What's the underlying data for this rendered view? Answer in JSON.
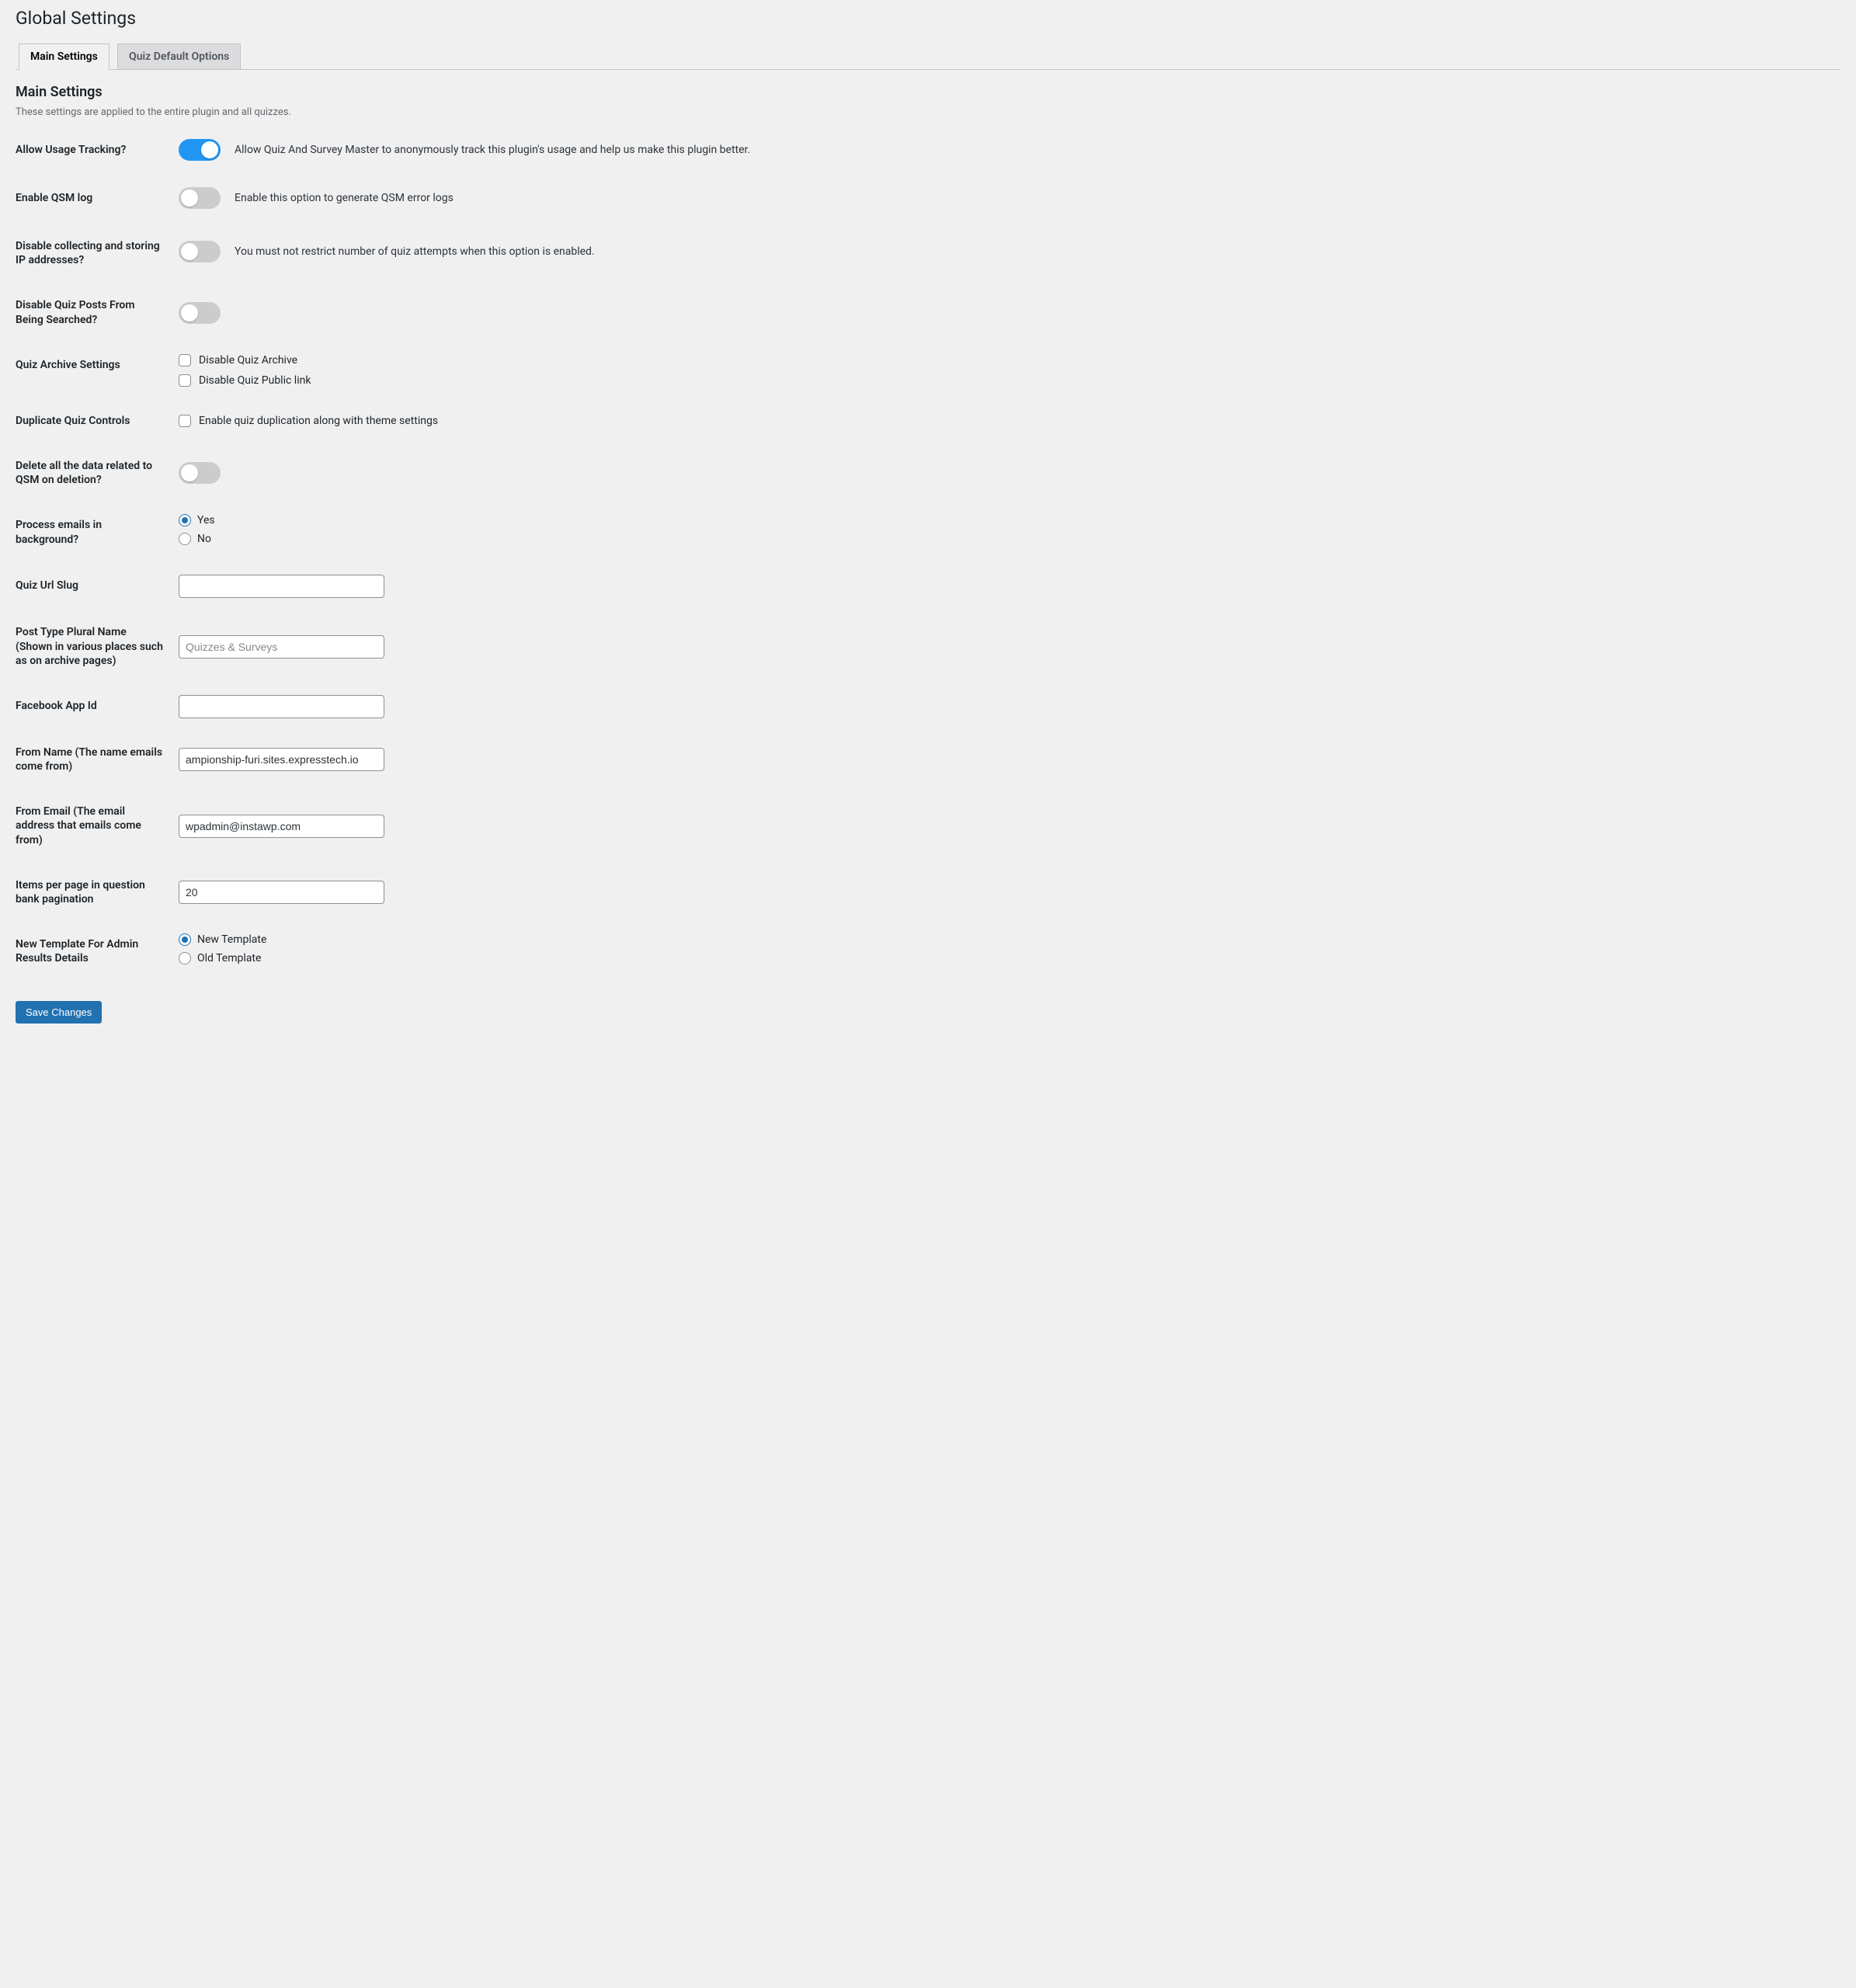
{
  "page_title": "Global Settings",
  "tabs": {
    "main": "Main Settings",
    "default": "Quiz Default Options"
  },
  "section_title": "Main Settings",
  "section_desc": "These settings are applied to the entire plugin and all quizzes.",
  "rows": {
    "tracking": {
      "label": "Allow Usage Tracking?",
      "desc": "Allow Quiz And Survey Master to anonymously track this plugin's usage and help us make this plugin better."
    },
    "qsmlog": {
      "label": "Enable QSM log",
      "desc": "Enable this option to generate QSM error logs"
    },
    "ip": {
      "label": "Disable collecting and storing IP addresses?",
      "desc": "You must not restrict number of quiz attempts when this option is enabled."
    },
    "search": {
      "label": "Disable Quiz Posts From Being Searched?"
    },
    "archive": {
      "label": "Quiz Archive Settings",
      "opt1": "Disable Quiz Archive",
      "opt2": "Disable Quiz Public link"
    },
    "duplicate": {
      "label": "Duplicate Quiz Controls",
      "opt1": "Enable quiz duplication along with theme settings"
    },
    "deletedata": {
      "label": "Delete all the data related to QSM on deletion?"
    },
    "emailsbg": {
      "label": "Process emails in background?",
      "yes": "Yes",
      "no": "No"
    },
    "slug": {
      "label": "Quiz Url Slug",
      "value": ""
    },
    "plural": {
      "label": "Post Type Plural Name (Shown in various places such as on archive pages)",
      "placeholder": "Quizzes & Surveys",
      "value": ""
    },
    "fbapp": {
      "label": "Facebook App Id",
      "value": ""
    },
    "fromname": {
      "label": "From Name (The name emails come from)",
      "value": "ampionship-furi.sites.expresstech.io"
    },
    "fromemail": {
      "label": "From Email (The email address that emails come from)",
      "value": "wpadmin@instawp.com"
    },
    "perpage": {
      "label": "Items per page in question bank pagination",
      "value": "20"
    },
    "template": {
      "label": "New Template For Admin Results Details",
      "new": "New Template",
      "old": "Old Template"
    }
  },
  "save_button": "Save Changes"
}
